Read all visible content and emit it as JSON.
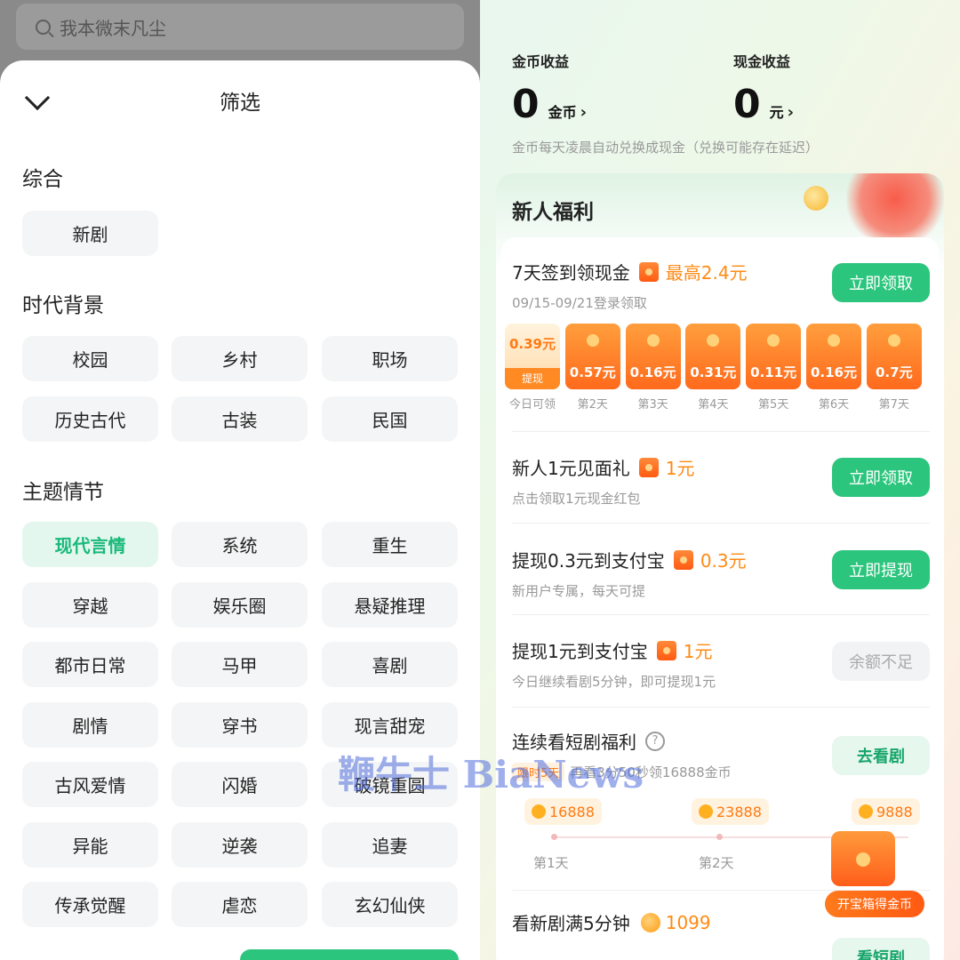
{
  "left": {
    "search_placeholder": "我本微末凡尘",
    "sheet_title": "筛选",
    "sections": [
      {
        "title": "综合",
        "items": [
          "新剧"
        ]
      },
      {
        "title": "时代背景",
        "items": [
          "校园",
          "乡村",
          "职场",
          "历史古代",
          "古装",
          "民国"
        ]
      },
      {
        "title": "主题情节",
        "items": [
          "现代言情",
          "系统",
          "重生",
          "穿越",
          "娱乐圈",
          "悬疑推理",
          "都市日常",
          "马甲",
          "喜剧",
          "剧情",
          "穿书",
          "现言甜宠",
          "古风爱情",
          "闪婚",
          "破镜重圆",
          "异能",
          "逆袭",
          "追妻",
          "传承觉醒",
          "虐恋",
          "玄幻仙侠"
        ]
      }
    ],
    "active_item": "现代言情"
  },
  "right": {
    "coin_label": "金币收益",
    "coin_value": "0",
    "coin_unit": "金币",
    "cash_label": "现金收益",
    "cash_value": "0",
    "cash_unit": "元",
    "note": "金币每天凌晨自动兑换成现金（兑换可能存在延迟）",
    "card_title": "新人福利",
    "tasks": [
      {
        "title": "7天签到领现金",
        "reward": "最高2.4元",
        "sub": "09/15-09/21登录领取",
        "button": "立即领取"
      },
      {
        "title": "新人1元见面礼",
        "reward": "1元",
        "sub": "点击领取1元现金红包",
        "button": "立即领取"
      },
      {
        "title": "提现0.3元到支付宝",
        "reward": "0.3元",
        "sub": "新用户专属，每天可提",
        "button": "立即提现"
      },
      {
        "title": "提现1元到支付宝",
        "reward": "1元",
        "sub": "今日继续看剧5分钟，即可提现1元",
        "button": "余额不足"
      },
      {
        "title": "连续看短剧福利",
        "reward": "",
        "sub": "再看3分50秒领16888金币",
        "limited": "限时5天",
        "button": "去看剧"
      },
      {
        "title": "看新剧满5分钟",
        "reward": "1099",
        "sub": "",
        "button": "看短剧"
      }
    ],
    "checkin_days": [
      {
        "amount": "0.39元",
        "label": "今日可领",
        "withdraw": "提现"
      },
      {
        "amount": "0.57元",
        "label": "第2天"
      },
      {
        "amount": "0.16元",
        "label": "第3天"
      },
      {
        "amount": "0.31元",
        "label": "第4天"
      },
      {
        "amount": "0.11元",
        "label": "第5天"
      },
      {
        "amount": "0.16元",
        "label": "第6天"
      },
      {
        "amount": "0.7元",
        "label": "第7天"
      }
    ],
    "streak": [
      {
        "coins": "16888",
        "label": "第1天"
      },
      {
        "coins": "23888",
        "label": "第2天"
      },
      {
        "coins": "9888",
        "label": ""
      }
    ],
    "chest_label": "开宝箱得金币",
    "help_mark": "?"
  },
  "watermark": "鞭牛士 BiaNews",
  "colors": {
    "accent_green": "#2cc57d",
    "reward_orange": "#ff8a14"
  }
}
